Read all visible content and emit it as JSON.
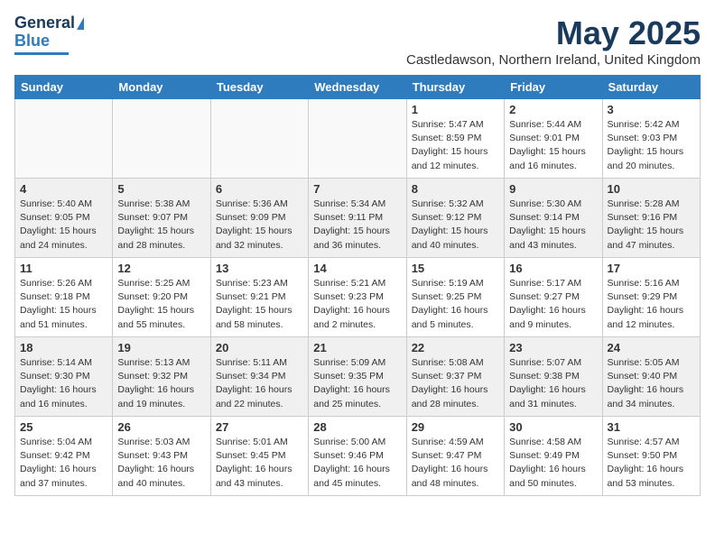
{
  "logo": {
    "line1": "General",
    "line2": "Blue"
  },
  "title": "May 2025",
  "subtitle": "Castledawson, Northern Ireland, United Kingdom",
  "days_of_week": [
    "Sunday",
    "Monday",
    "Tuesday",
    "Wednesday",
    "Thursday",
    "Friday",
    "Saturday"
  ],
  "weeks": [
    [
      {
        "day": "",
        "info": ""
      },
      {
        "day": "",
        "info": ""
      },
      {
        "day": "",
        "info": ""
      },
      {
        "day": "",
        "info": ""
      },
      {
        "day": "1",
        "info": "Sunrise: 5:47 AM\nSunset: 8:59 PM\nDaylight: 15 hours\nand 12 minutes."
      },
      {
        "day": "2",
        "info": "Sunrise: 5:44 AM\nSunset: 9:01 PM\nDaylight: 15 hours\nand 16 minutes."
      },
      {
        "day": "3",
        "info": "Sunrise: 5:42 AM\nSunset: 9:03 PM\nDaylight: 15 hours\nand 20 minutes."
      }
    ],
    [
      {
        "day": "4",
        "info": "Sunrise: 5:40 AM\nSunset: 9:05 PM\nDaylight: 15 hours\nand 24 minutes."
      },
      {
        "day": "5",
        "info": "Sunrise: 5:38 AM\nSunset: 9:07 PM\nDaylight: 15 hours\nand 28 minutes."
      },
      {
        "day": "6",
        "info": "Sunrise: 5:36 AM\nSunset: 9:09 PM\nDaylight: 15 hours\nand 32 minutes."
      },
      {
        "day": "7",
        "info": "Sunrise: 5:34 AM\nSunset: 9:11 PM\nDaylight: 15 hours\nand 36 minutes."
      },
      {
        "day": "8",
        "info": "Sunrise: 5:32 AM\nSunset: 9:12 PM\nDaylight: 15 hours\nand 40 minutes."
      },
      {
        "day": "9",
        "info": "Sunrise: 5:30 AM\nSunset: 9:14 PM\nDaylight: 15 hours\nand 43 minutes."
      },
      {
        "day": "10",
        "info": "Sunrise: 5:28 AM\nSunset: 9:16 PM\nDaylight: 15 hours\nand 47 minutes."
      }
    ],
    [
      {
        "day": "11",
        "info": "Sunrise: 5:26 AM\nSunset: 9:18 PM\nDaylight: 15 hours\nand 51 minutes."
      },
      {
        "day": "12",
        "info": "Sunrise: 5:25 AM\nSunset: 9:20 PM\nDaylight: 15 hours\nand 55 minutes."
      },
      {
        "day": "13",
        "info": "Sunrise: 5:23 AM\nSunset: 9:21 PM\nDaylight: 15 hours\nand 58 minutes."
      },
      {
        "day": "14",
        "info": "Sunrise: 5:21 AM\nSunset: 9:23 PM\nDaylight: 16 hours\nand 2 minutes."
      },
      {
        "day": "15",
        "info": "Sunrise: 5:19 AM\nSunset: 9:25 PM\nDaylight: 16 hours\nand 5 minutes."
      },
      {
        "day": "16",
        "info": "Sunrise: 5:17 AM\nSunset: 9:27 PM\nDaylight: 16 hours\nand 9 minutes."
      },
      {
        "day": "17",
        "info": "Sunrise: 5:16 AM\nSunset: 9:29 PM\nDaylight: 16 hours\nand 12 minutes."
      }
    ],
    [
      {
        "day": "18",
        "info": "Sunrise: 5:14 AM\nSunset: 9:30 PM\nDaylight: 16 hours\nand 16 minutes."
      },
      {
        "day": "19",
        "info": "Sunrise: 5:13 AM\nSunset: 9:32 PM\nDaylight: 16 hours\nand 19 minutes."
      },
      {
        "day": "20",
        "info": "Sunrise: 5:11 AM\nSunset: 9:34 PM\nDaylight: 16 hours\nand 22 minutes."
      },
      {
        "day": "21",
        "info": "Sunrise: 5:09 AM\nSunset: 9:35 PM\nDaylight: 16 hours\nand 25 minutes."
      },
      {
        "day": "22",
        "info": "Sunrise: 5:08 AM\nSunset: 9:37 PM\nDaylight: 16 hours\nand 28 minutes."
      },
      {
        "day": "23",
        "info": "Sunrise: 5:07 AM\nSunset: 9:38 PM\nDaylight: 16 hours\nand 31 minutes."
      },
      {
        "day": "24",
        "info": "Sunrise: 5:05 AM\nSunset: 9:40 PM\nDaylight: 16 hours\nand 34 minutes."
      }
    ],
    [
      {
        "day": "25",
        "info": "Sunrise: 5:04 AM\nSunset: 9:42 PM\nDaylight: 16 hours\nand 37 minutes."
      },
      {
        "day": "26",
        "info": "Sunrise: 5:03 AM\nSunset: 9:43 PM\nDaylight: 16 hours\nand 40 minutes."
      },
      {
        "day": "27",
        "info": "Sunrise: 5:01 AM\nSunset: 9:45 PM\nDaylight: 16 hours\nand 43 minutes."
      },
      {
        "day": "28",
        "info": "Sunrise: 5:00 AM\nSunset: 9:46 PM\nDaylight: 16 hours\nand 45 minutes."
      },
      {
        "day": "29",
        "info": "Sunrise: 4:59 AM\nSunset: 9:47 PM\nDaylight: 16 hours\nand 48 minutes."
      },
      {
        "day": "30",
        "info": "Sunrise: 4:58 AM\nSunset: 9:49 PM\nDaylight: 16 hours\nand 50 minutes."
      },
      {
        "day": "31",
        "info": "Sunrise: 4:57 AM\nSunset: 9:50 PM\nDaylight: 16 hours\nand 53 minutes."
      }
    ]
  ]
}
